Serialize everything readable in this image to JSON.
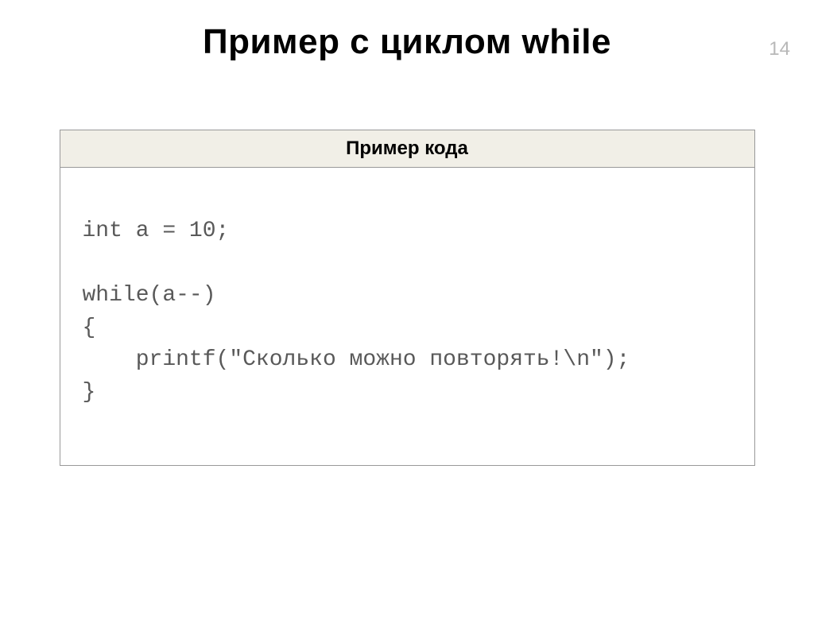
{
  "pageNumber": "14",
  "title": "Пример с циклом while",
  "codeBlock": {
    "header": "Пример кода",
    "code": "int a = 10;\n\nwhile(a--)\n{\n    printf(\"Сколько можно повторять!\\n\");\n}"
  }
}
